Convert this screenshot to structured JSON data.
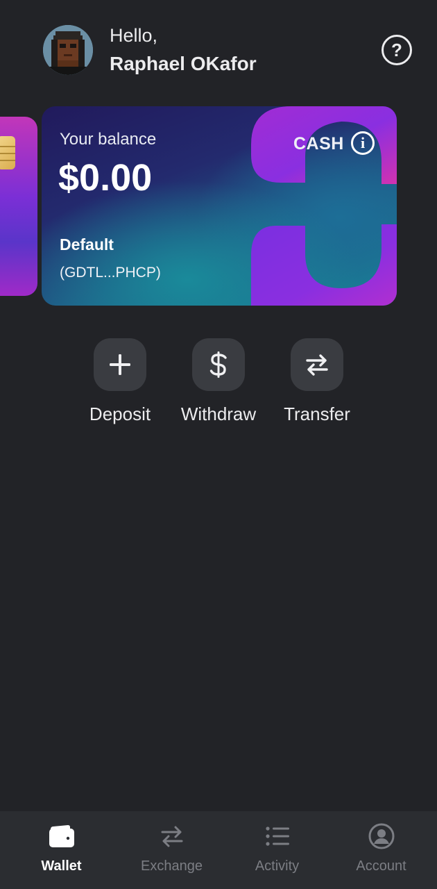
{
  "header": {
    "greeting": "Hello,",
    "user_name": "Raphael OKafor",
    "help_icon_glyph": "?",
    "avatar_icon": "pixel-avatar-icon"
  },
  "card": {
    "balance_label": "Your balance",
    "balance_amount": "$0.00",
    "card_type": "CASH",
    "info_icon_glyph": "i",
    "account_name": "Default",
    "account_address": "(GDTL...PHCP)",
    "colors": {
      "gradient_start": "#211a5c",
      "gradient_end": "#178a98",
      "accent_purple": "#8a2fe0",
      "accent_pink": "#d232b0"
    }
  },
  "actions": [
    {
      "label": "Deposit",
      "icon": "plus-icon"
    },
    {
      "label": "Withdraw",
      "icon": "dollar-icon"
    },
    {
      "label": "Transfer",
      "icon": "transfer-arrows-icon"
    }
  ],
  "bottom_nav": {
    "items": [
      {
        "label": "Wallet",
        "icon": "wallet-icon",
        "active": true
      },
      {
        "label": "Exchange",
        "icon": "exchange-icon",
        "active": false
      },
      {
        "label": "Activity",
        "icon": "list-icon",
        "active": false
      },
      {
        "label": "Account",
        "icon": "account-icon",
        "active": false
      }
    ],
    "active_color": "#ffffff",
    "inactive_color": "#7c7e84"
  },
  "theme": {
    "background": "#222327",
    "button_background": "#3a3c41",
    "nav_background": "#2b2d31"
  }
}
